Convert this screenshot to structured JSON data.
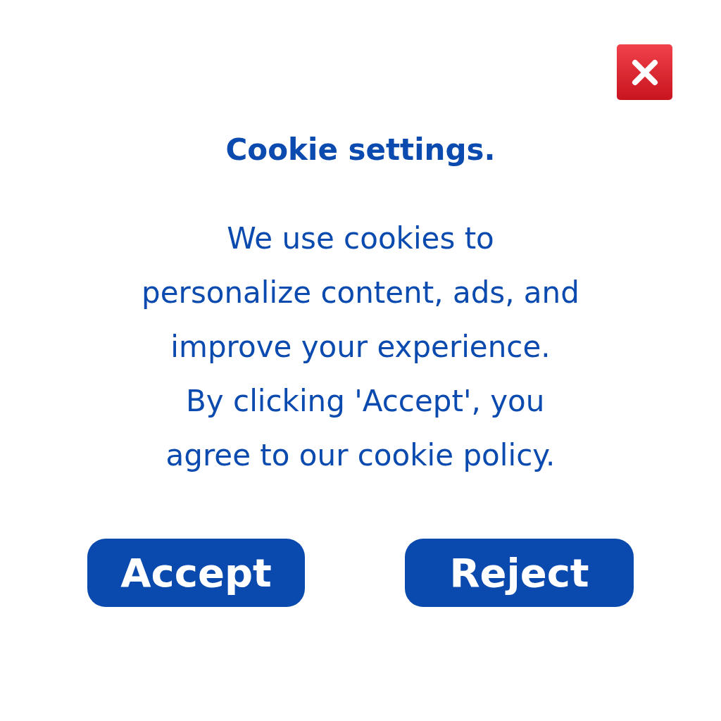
{
  "dialog": {
    "title": "Cookie settings.",
    "message_lines": [
      "We use cookies to",
      "personalize content, ads, and",
      "improve your experience.",
      " By clicking 'Accept', you",
      "agree to our cookie policy."
    ],
    "buttons": [
      {
        "label": "Accept",
        "kind": "primary"
      },
      {
        "label": "Reject",
        "kind": "primary"
      }
    ]
  }
}
